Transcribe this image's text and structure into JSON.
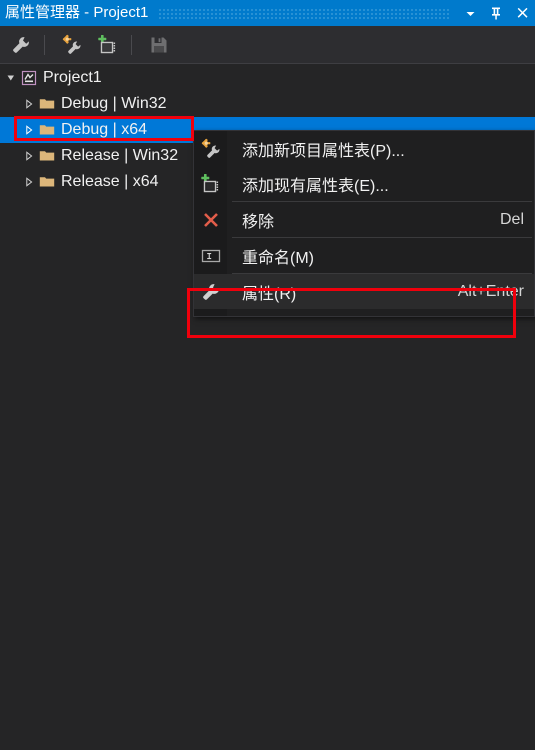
{
  "window": {
    "title": "属性管理器 - Project1",
    "buttons": [
      {
        "name": "dropdown-menu-button",
        "icon": "chevron-down-icon",
        "label": "▼"
      },
      {
        "name": "pin-button",
        "icon": "pin-icon",
        "label": "Pin"
      },
      {
        "name": "close-button",
        "icon": "close-icon",
        "label": "✕"
      }
    ],
    "accent_color": "#007ACC",
    "background_color": "#252526"
  },
  "toolbar": {
    "buttons": [
      {
        "name": "properties-button",
        "icon": "wrench-icon",
        "tooltip": "属性"
      },
      {
        "name": "add-new-project-property-sheet-button",
        "icon": "new-property-sheet-icon",
        "tooltip": "添加新项目属性表"
      },
      {
        "name": "add-existing-property-sheet-button",
        "icon": "add-existing-property-sheet-icon",
        "tooltip": "添加现有属性表"
      },
      {
        "name": "save-button",
        "icon": "save-disk-icon",
        "tooltip": "保存",
        "disabled": true
      }
    ]
  },
  "tree": {
    "root": {
      "label": "Project1",
      "icon": "property-sheet-icon",
      "expanded": true
    },
    "nodes": [
      {
        "label": "Debug | Win32",
        "icon": "folder-icon",
        "expanded": false,
        "selected": false
      },
      {
        "label": "Debug | x64",
        "icon": "folder-icon",
        "expanded": false,
        "selected": true
      },
      {
        "label": "Release | Win32",
        "icon": "folder-icon",
        "expanded": false,
        "selected": false
      },
      {
        "label": "Release | x64",
        "icon": "folder-icon",
        "expanded": false,
        "selected": false
      }
    ],
    "selection_color": "#0078D7"
  },
  "context_menu": {
    "items": [
      {
        "label": "添加新项目属性表(P)...",
        "shortcut": "",
        "icon": "new-property-sheet-icon",
        "highlighted": false
      },
      {
        "label": "添加现有属性表(E)...",
        "shortcut": "",
        "icon": "add-existing-property-sheet-icon",
        "highlighted": false
      },
      {
        "label": "移除",
        "shortcut": "Del",
        "icon": "red-x-icon",
        "highlighted": false
      },
      {
        "label": "重命名(M)",
        "shortcut": "",
        "icon": "rename-textbox-icon",
        "highlighted": false
      },
      {
        "label": "属性(R)",
        "shortcut": "Alt+Enter",
        "icon": "wrench-icon",
        "highlighted": true
      }
    ],
    "background_color": "#1F1F20"
  },
  "annotations": {
    "highlight_color": "#F0000C",
    "boxes": [
      {
        "name": "selected-tree-node-highlight",
        "target": "Debug | x64"
      },
      {
        "name": "properties-menu-item-highlight",
        "target": "属性(R)"
      }
    ]
  }
}
